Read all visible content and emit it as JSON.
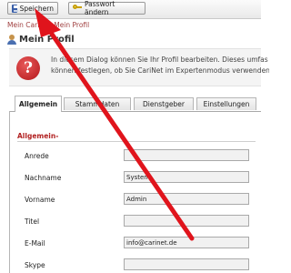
{
  "toolbar": {
    "save_label": "Speichern",
    "password_label": "Passwort ändern"
  },
  "breadcrumb": {
    "root": "Mein CariN",
    "separator": ">",
    "current": "Mein Profil"
  },
  "page": {
    "title": "Mein Profil"
  },
  "info": {
    "icon": "?",
    "line1": "In diesem Dialog können Sie Ihr Profil bearbeiten. Dieses umfas",
    "line2": "können festlegen, ob Sie CariNet im Expertenmodus verwenden"
  },
  "tabs": [
    {
      "label": "Allgemein",
      "active": true
    },
    {
      "label": "Stammdaten",
      "active": false
    },
    {
      "label": "Dienstgeber",
      "active": false
    },
    {
      "label": "Einstellungen",
      "active": false
    }
  ],
  "section": {
    "title": "Allgemein",
    "marker": "-"
  },
  "fields": [
    {
      "label": "Anrede",
      "value": ""
    },
    {
      "label": "Nachname",
      "value": "System"
    },
    {
      "label": "Vorname",
      "value": "Admin"
    },
    {
      "label": "Titel",
      "value": ""
    },
    {
      "label": "E-Mail",
      "value": "info@carinet.de"
    },
    {
      "label": "Skype",
      "value": ""
    }
  ],
  "colors": {
    "arrow": "#e0141c",
    "section_title": "#b22222",
    "breadcrumb": "#a04040"
  }
}
